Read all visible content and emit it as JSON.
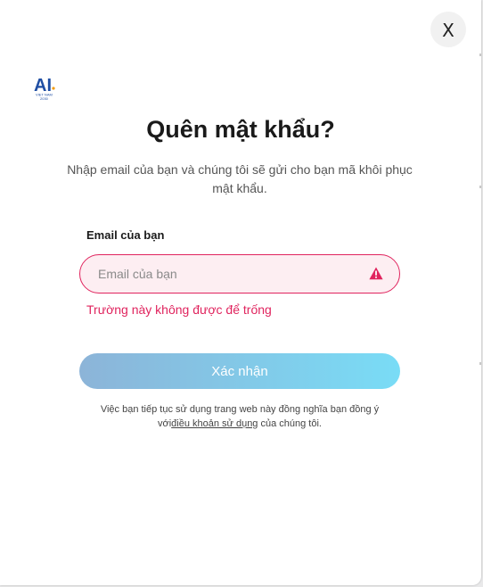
{
  "close_button": {
    "label": "X"
  },
  "logo": {
    "text": "AI",
    "subtext_line1": "VIET NAM",
    "subtext_line2": "2030",
    "color": "#1f4ea3"
  },
  "title": "Quên mật khẩu?",
  "subtitle": "Nhập email của bạn và chúng tôi sẽ gửi cho bạn mã khôi phục mật khẩu.",
  "email_field": {
    "label": "Email của bạn",
    "placeholder": "Email của bạn",
    "value": "",
    "error": "Trường này không được để trống"
  },
  "submit_button": {
    "label": "Xác nhận"
  },
  "terms": {
    "prefix": "Việc bạn tiếp tục sử dụng trang web này đồng nghĩa bạn đồng ý với",
    "link": "điều khoản sử dụng",
    "suffix": " của chúng tôi."
  },
  "icons": {
    "close": "close-icon",
    "warning": "warning-icon",
    "logo": "ai-vietnam-logo"
  },
  "colors": {
    "error": "#e0245e",
    "error_bg": "#fdeef2",
    "button_gradient_start": "#8cb4d8",
    "button_gradient_end": "#79dcf6"
  }
}
